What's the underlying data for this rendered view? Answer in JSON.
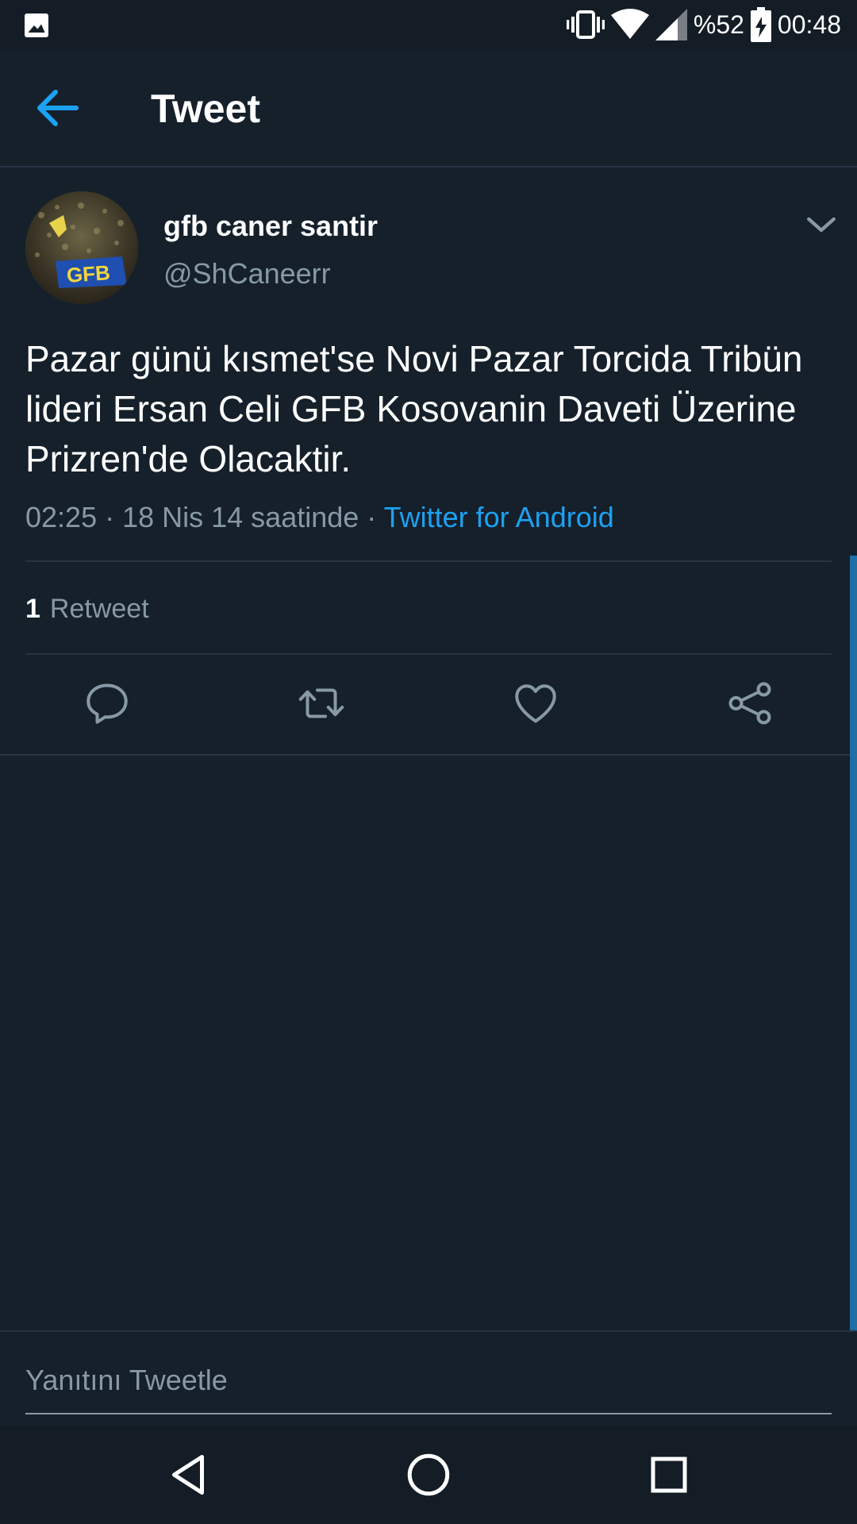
{
  "status_bar": {
    "battery": "%52",
    "time": "00:48"
  },
  "header": {
    "title": "Tweet"
  },
  "tweet": {
    "author_name": "gfb caner santir",
    "author_handle": "@ShCaneerr",
    "avatar_banner_text": "GFB",
    "text": "Pazar günü kısmet'se Novi Pazar Torcida Tribün lideri Ersan Celi GFB Kosovanin Daveti Üzerine Prizren'de Olacaktir.",
    "timestamp": "02:25 · 18 Nis 14 saatinde · ",
    "source": "Twitter for Android",
    "retweet_count": "1",
    "retweet_label": "Retweet"
  },
  "reply": {
    "placeholder": "Yanıtını Tweetle"
  },
  "colors": {
    "background": "#15202b",
    "accent": "#1da1f2",
    "secondary_text": "#8899a6",
    "divider": "#253341"
  }
}
